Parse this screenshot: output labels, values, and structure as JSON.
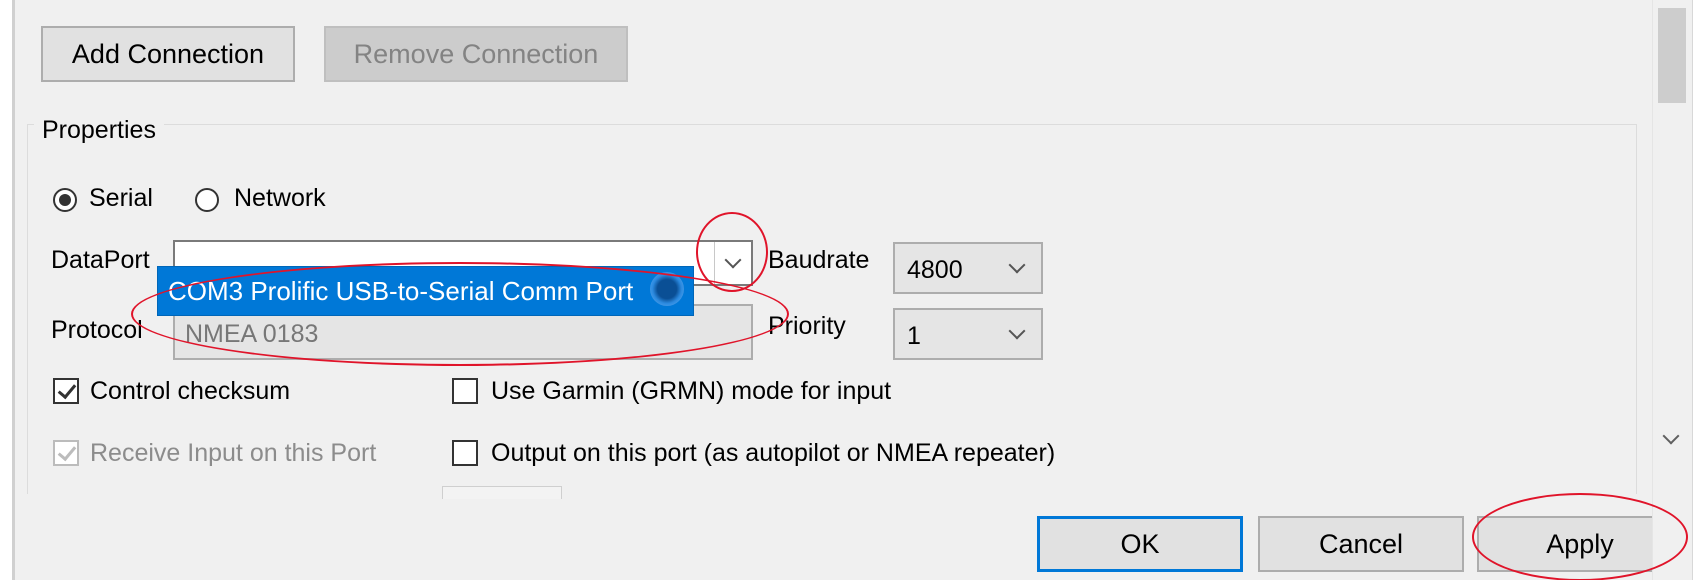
{
  "toolbar": {
    "add_connection": "Add Connection",
    "remove_connection": "Remove Connection"
  },
  "properties": {
    "group_label": "Properties",
    "radio_serial": "Serial",
    "radio_network": "Network",
    "serial_selected": true,
    "dataport_label": "DataPort",
    "dataport_value": "",
    "dataport_dropdown_option": "COM3 Prolific USB-to-Serial Comm Port",
    "baudrate_label": "Baudrate",
    "baudrate_value": "4800",
    "protocol_label": "Protocol",
    "protocol_value": "NMEA 0183",
    "priority_label": "Priority",
    "priority_value": "1",
    "control_checksum": "Control checksum",
    "control_checksum_checked": true,
    "receive_input": "Receive Input on this Port",
    "receive_input_checked": true,
    "use_garmin": "Use Garmin (GRMN) mode for input",
    "use_garmin_checked": false,
    "output_port": "Output on this port (as autopilot or NMEA repeater)",
    "output_port_checked": false
  },
  "footer": {
    "ok": "OK",
    "cancel": "Cancel",
    "apply": "Apply"
  },
  "colors": {
    "selection": "#0078d7",
    "annotation": "#e0142a",
    "window_bg": "#f0f0f0"
  }
}
